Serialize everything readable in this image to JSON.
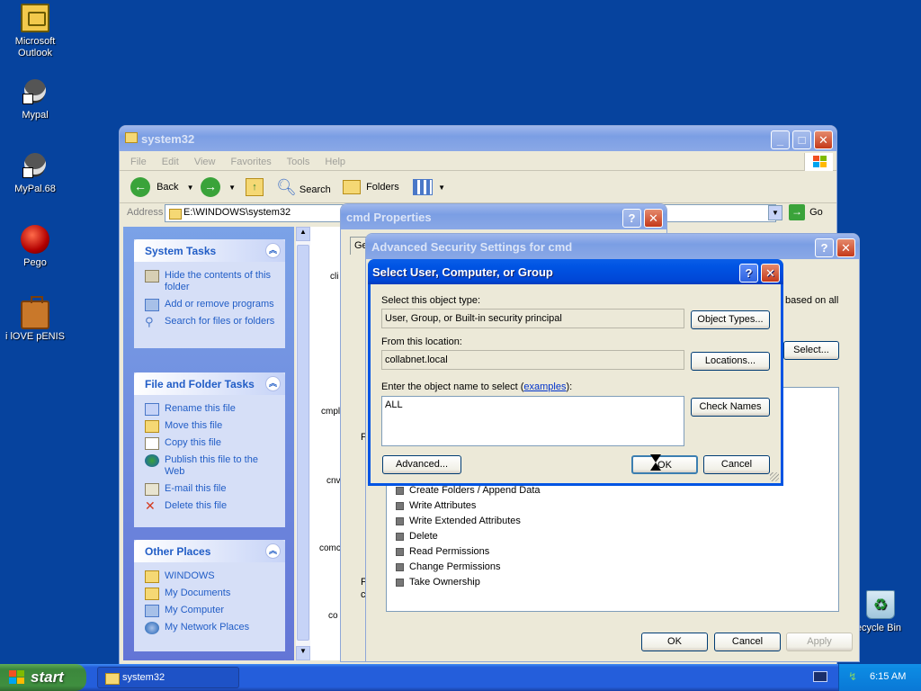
{
  "desktop": {
    "icons": [
      {
        "label": "Microsoft Outlook"
      },
      {
        "label": "Mypal"
      },
      {
        "label": "MyPal.68"
      },
      {
        "label": "Pego"
      },
      {
        "label": "i lOVE pENIS"
      },
      {
        "label": "Recycle Bin"
      }
    ]
  },
  "explorer": {
    "title": "system32",
    "menu": [
      "File",
      "Edit",
      "View",
      "Favorites",
      "Tools",
      "Help"
    ],
    "toolbar": {
      "back": "Back",
      "search": "Search",
      "folders": "Folders"
    },
    "address": {
      "label": "Address",
      "value": "E:\\WINDOWS\\system32",
      "go": "Go"
    },
    "system_tasks": {
      "title": "System Tasks",
      "items": [
        "Hide the contents of this folder",
        "Add or remove programs",
        "Search for files or folders"
      ]
    },
    "file_tasks": {
      "title": "File and Folder Tasks",
      "items": [
        "Rename this file",
        "Move this file",
        "Copy this file",
        "Publish this file to the Web",
        "E-mail this file",
        "Delete this file"
      ]
    },
    "other_places": {
      "title": "Other Places",
      "items": [
        "WINDOWS",
        "My Documents",
        "My Computer",
        "My Network Places"
      ]
    },
    "file_fragments": [
      "cli",
      "cmpl",
      "cnv",
      "comc",
      "co"
    ]
  },
  "props_dialog": {
    "title": "cmd Properties",
    "tab_fragment": "Ge",
    "fragments": [
      "F",
      "F",
      "c"
    ]
  },
  "adv_dialog": {
    "title": "Advanced Security Settings for cmd",
    "side_text": "based on all",
    "select_button": "Select...",
    "permissions": [
      "Create Folders / Append Data",
      "Write Attributes",
      "Write Extended Attributes",
      "Delete",
      "Read Permissions",
      "Change Permissions",
      "Take Ownership"
    ],
    "ok": "OK",
    "cancel": "Cancel",
    "apply": "Apply"
  },
  "select_dialog": {
    "title": "Select User, Computer, or Group",
    "object_type_label": "Select this object type:",
    "object_type_value": "User, Group, or Built-in security principal",
    "object_types_button": "Object Types...",
    "location_label": "From this location:",
    "location_value": "collabnet.local",
    "locations_button": "Locations...",
    "enter_label": "Enter the object name to select (",
    "examples_link": "examples",
    "enter_label_end": "):",
    "name_value": "ALL",
    "check_names_button": "Check Names",
    "advanced_button": "Advanced...",
    "ok_button": "OK",
    "cancel_button": "Cancel"
  },
  "taskbar": {
    "start": "start",
    "task": "system32",
    "clock": "6:15 AM"
  }
}
